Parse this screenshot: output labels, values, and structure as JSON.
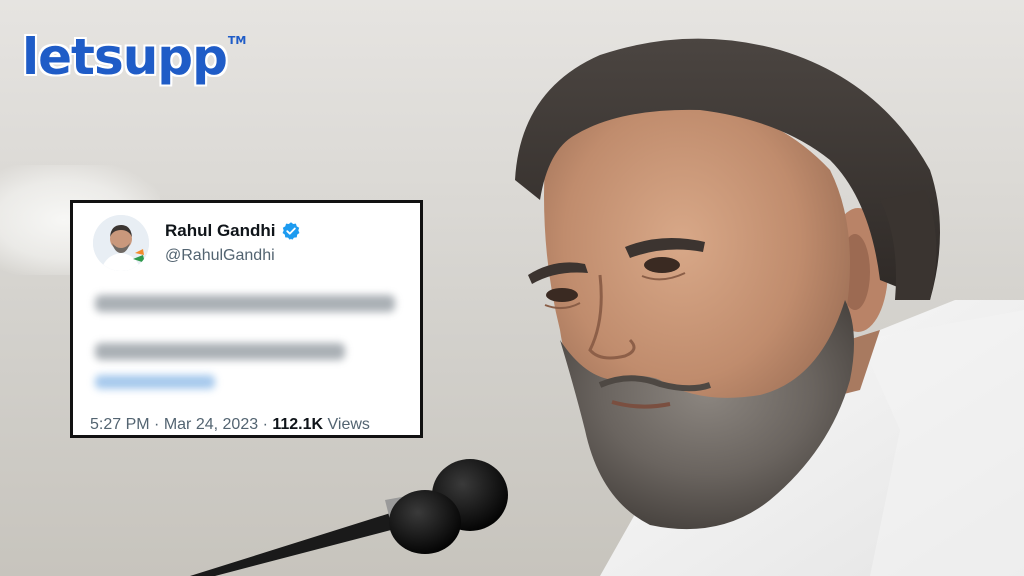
{
  "logo": {
    "text": "letsupp",
    "trademark": "TM",
    "color": "#1f5cc7"
  },
  "tweet": {
    "display_name": "Rahul Gandhi",
    "handle": "@RahulGandhi",
    "verified_icon": "verified-badge-icon",
    "time": "5:27 PM",
    "date": "Mar 24, 2023",
    "separator": "·",
    "views_count": "112.1K",
    "views_label": "Views",
    "body_text_blurred": true
  },
  "colors": {
    "accent_blue": "#1d9bf0",
    "tweet_text": "#0f1419",
    "tweet_secondary": "#536471"
  }
}
